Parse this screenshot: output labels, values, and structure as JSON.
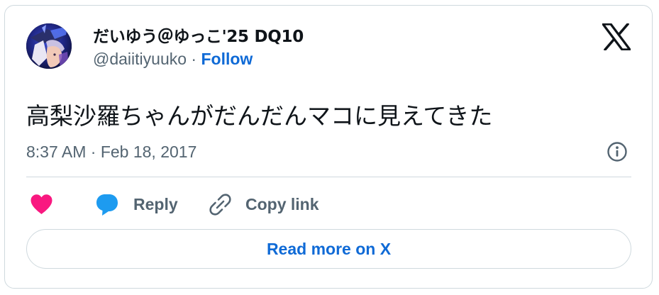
{
  "tweet": {
    "author": {
      "display_name": "だいゆう＠ゆっこ'25 DQ10",
      "handle": "@daiitiyuuko",
      "separator": " · ",
      "follow_label": "Follow",
      "avatar_icon": "user-avatar-image"
    },
    "text": "高梨沙羅ちゃんがだんだんマコに見えてきた",
    "timestamp": "8:37 AM · Feb 18, 2017",
    "actions": {
      "like_icon": "heart-icon",
      "reply_label": "Reply",
      "reply_icon": "speech-bubble-icon",
      "copy_label": "Copy link",
      "copy_icon": "link-icon"
    },
    "read_more_label": "Read more on X",
    "brand_icon": "x-logo-icon",
    "info_icon": "info-icon"
  },
  "colors": {
    "text_primary": "#0f1419",
    "text_secondary": "#536471",
    "link_blue": "#0f6ad6",
    "heart_pink": "#f91880",
    "reply_blue": "#1d9bf0",
    "border": "#cfd9de"
  }
}
